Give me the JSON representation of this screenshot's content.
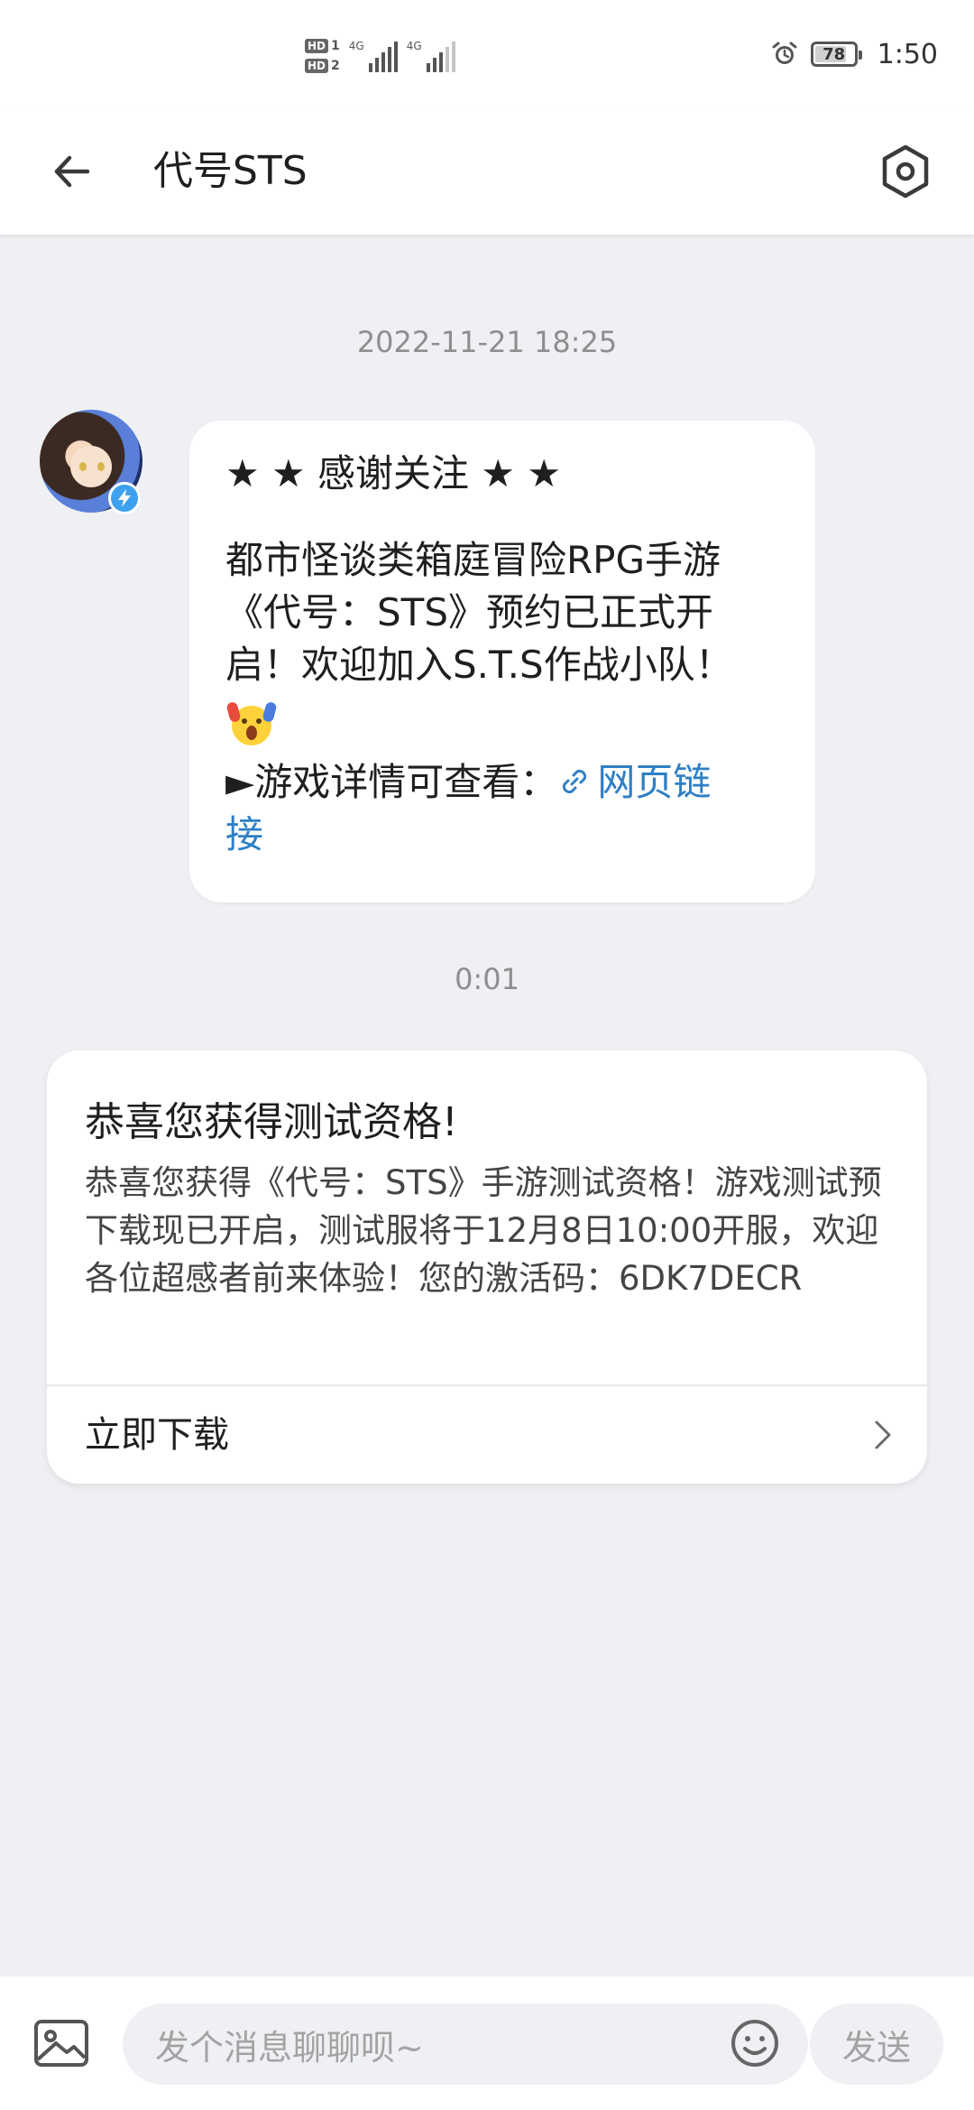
{
  "status_bar": {
    "sim1_label": "HD",
    "sim1_index": "1",
    "sim2_label": "HD",
    "sim2_index": "2",
    "network1": "4G",
    "network2": "4G",
    "battery_level": "78",
    "time": "1:50",
    "icons": [
      "alarm-icon",
      "battery-icon",
      "signal-icon"
    ]
  },
  "header": {
    "title": "代号STS",
    "back_icon": "arrow-left",
    "settings_icon": "hexagon-gear"
  },
  "chat": {
    "first_timestamp": "2022-11-21 18:25",
    "message": {
      "title": "★ ★ 感谢关注 ★ ★",
      "body_line1": "都市怪谈类箱庭冒险RPG手游",
      "body_line2": "《代号：STS》预约已正式开",
      "body_line3": "启！欢迎加入S.T.S作战小队！",
      "details_prefix": "►游戏详情可查看：",
      "link_text_part1": "网页链",
      "link_text_part2": "接"
    },
    "second_timestamp": "0:01",
    "card": {
      "title": "恭喜您获得测试资格!",
      "body": "恭喜您获得《代号：STS》手游测试资格！游戏测试预下载现已开启，测试服将于12月8日10:00开服，欢迎各位超感者前来体验！您的激活码：6DK7DECR",
      "action_label": "立即下载"
    }
  },
  "input_bar": {
    "placeholder": "发个消息聊聊呗~",
    "send_label": "发送"
  },
  "colors": {
    "background": "#eef0f3",
    "link": "#2f7fc4",
    "verified": "#3ea1f0",
    "placeholder": "#a3a3a3"
  }
}
